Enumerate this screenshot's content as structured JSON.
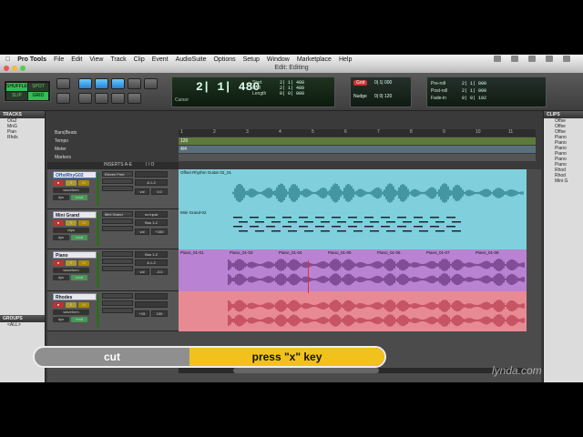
{
  "menubar": {
    "app": "Pro Tools",
    "items": [
      "File",
      "Edit",
      "View",
      "Track",
      "Clip",
      "Event",
      "AudioSuite",
      "Options",
      "Setup",
      "Window",
      "Marketplace",
      "Help"
    ]
  },
  "window": {
    "title": "Edit: Editing"
  },
  "toolbar": {
    "modes": [
      "SHUFFLE",
      "SPOT",
      "SLIP",
      "GRID"
    ],
    "counter": {
      "main": "2| 1| 480",
      "cursor_label": "Cursor",
      "sel_labels": [
        "Start",
        "End",
        "Length"
      ],
      "sel_values": [
        "2| 1| 480",
        "2| 1| 480",
        "0| 0| 000"
      ]
    },
    "grid": {
      "grid_label": "Grid",
      "grid_value": "0| 1| 000",
      "nudge_label": "Nudge",
      "nudge_value": "0| 0| 120"
    },
    "prepost": {
      "labels": [
        "Pre-roll",
        "Post-roll",
        "Fade-in"
      ],
      "values": [
        "2| 1| 000",
        "2| 1| 000",
        "0| 0| 192"
      ]
    }
  },
  "panels": {
    "tracks": {
      "title": "TRACKS",
      "items": [
        "OG2",
        "MnG",
        "Pian",
        "Rhds"
      ]
    },
    "groups": {
      "title": "GROUPS",
      "items": [
        "<ALL>"
      ]
    },
    "clips": {
      "title": "CLIPS",
      "items": [
        "Offse",
        "Offse",
        "Offse",
        "Piano",
        "Piano",
        "Piano",
        "Piano",
        "Piano",
        "Piano",
        "Rhod",
        "Rhod",
        "Mini G"
      ]
    }
  },
  "timeline": {
    "rows": [
      "Bars|Beats",
      "Tempo",
      "Meter",
      "Markers"
    ],
    "bars": [
      "1",
      "2",
      "3",
      "4",
      "5",
      "6",
      "7",
      "8",
      "9",
      "10",
      "11"
    ],
    "tempo_value": "120",
    "meter_value": "4/4",
    "inserts_header": "INSERTS A-E",
    "io_header": "I / O"
  },
  "tracks": [
    {
      "name": "OffstRhyG02",
      "insert": "Eleven Free",
      "io_in": "",
      "io_out": "A 1-2",
      "view": "waveform",
      "vol": "vol",
      "pan": "0.0",
      "clips": [
        "Offset Rhythm Guitar 02_01"
      ],
      "color": "#7fd0dc"
    },
    {
      "name": "Mini Grand",
      "insert": "Mini Grand",
      "io_in": "no input",
      "io_out": "Bus 1-2",
      "view": "clips",
      "vol": "vol",
      "pan": "+100",
      "clips": [
        "Mini Grand-02"
      ],
      "color": "#7fd0dc"
    },
    {
      "name": "Piano",
      "insert": "",
      "io_in": "Bus 1-2",
      "io_out": "A 1-2",
      "view": "waveform",
      "vol": "vol",
      "pan": "-3.0",
      "clips": [
        "Piano_01-01",
        "Piano_01-03",
        "Piano_01-04",
        "Piano_01-05",
        "Piano_01-06",
        "Piano_01-07",
        "Piano_01-08"
      ],
      "color": "#b982d2"
    },
    {
      "name": "Rhodes",
      "insert": "",
      "io_in": "",
      "io_out": "",
      "view": "waveform",
      "vol": "+15",
      "pan": "100",
      "clips": [],
      "color": "#e88a94"
    }
  ],
  "overlay": {
    "left": "cut",
    "right": "press \"x\" key"
  },
  "watermark": "lynda.com"
}
